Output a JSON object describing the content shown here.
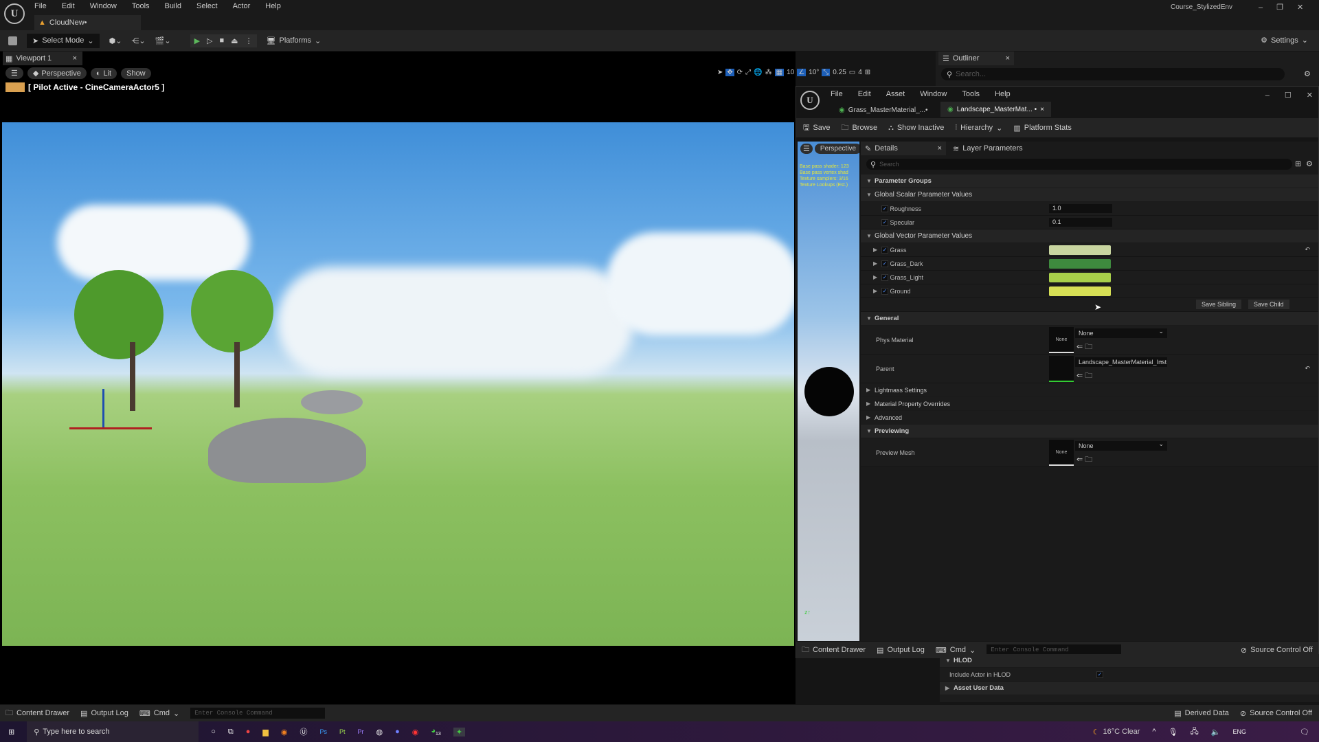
{
  "app": {
    "title": "Course_StylizedEnv",
    "menu": [
      "File",
      "Edit",
      "Window",
      "Tools",
      "Build",
      "Select",
      "Actor",
      "Help"
    ],
    "level_tab": "CloudNew•"
  },
  "toolbar": {
    "select_mode": "Select Mode",
    "platforms": "Platforms",
    "settings": "Settings"
  },
  "viewport": {
    "tab": "Viewport 1",
    "perspective": "Perspective",
    "lit": "Lit",
    "show": "Show",
    "pilot": "[ Pilot Active - CineCameraActor5 ]",
    "grid": "10",
    "angle": "10°",
    "scale": "0.25",
    "camera_speed": "4"
  },
  "outliner": {
    "tab": "Outliner",
    "search_placeholder": "Search..."
  },
  "material_editor": {
    "menu": [
      "File",
      "Edit",
      "Asset",
      "Window",
      "Tools",
      "Help"
    ],
    "tabs": [
      {
        "label": "Grass_MasterMaterial_...•"
      },
      {
        "label": "Landscape_MasterMat... •"
      }
    ],
    "toolbar": {
      "save": "Save",
      "browse": "Browse",
      "show_inactive": "Show Inactive",
      "hierarchy": "Hierarchy",
      "platform_stats": "Platform Stats"
    },
    "preview": {
      "perspective": "Perspective",
      "stats": [
        "Base pass shader: 123",
        "Base pass vertex shad",
        "Texture samplers: 3/16",
        "Texture Lookups (Est.)"
      ]
    },
    "details": {
      "tab": "Details",
      "layer_tab": "Layer Parameters",
      "search_placeholder": "Search",
      "parameter_groups": "Parameter Groups",
      "scalar_header": "Global Scalar Parameter Values",
      "scalars": [
        {
          "name": "Roughness",
          "value": "1.0",
          "enabled": true
        },
        {
          "name": "Specular",
          "value": "0.1",
          "enabled": true
        }
      ],
      "vector_header": "Global Vector Parameter Values",
      "vectors": [
        {
          "name": "Grass",
          "color": "#c8d5a0",
          "enabled": true
        },
        {
          "name": "Grass_Dark",
          "color": "#3e8a3e",
          "enabled": true
        },
        {
          "name": "Grass_Light",
          "color": "#a8cf4a",
          "enabled": true
        },
        {
          "name": "Ground",
          "color": "#d6df55",
          "enabled": true
        }
      ],
      "save_sibling": "Save Sibling",
      "save_child": "Save Child",
      "general": "General",
      "phys_material": "Phys Material",
      "phys_value": "None",
      "thumb_none": "None",
      "parent": "Parent",
      "parent_value": "Landscape_MasterMaterial_Inst",
      "lightmass": "Lightmass Settings",
      "mpo": "Material Property Overrides",
      "advanced": "Advanced",
      "previewing": "Previewing",
      "preview_mesh": "Preview Mesh",
      "preview_mesh_value": "None"
    },
    "bottom": {
      "content_drawer": "Content Drawer",
      "output_log": "Output Log",
      "cmd": "Cmd",
      "console_placeholder": "Enter Console Command",
      "source_control": "Source Control Off"
    }
  },
  "hlod": {
    "header": "HLOD",
    "include": "Include Actor in HLOD",
    "include_checked": true,
    "asset_user_data": "Asset User Data"
  },
  "statusbar": {
    "content_drawer": "Content Drawer",
    "output_log": "Output Log",
    "cmd": "Cmd",
    "console_placeholder": "Enter Console Command",
    "derived_data": "Derived Data",
    "source_control": "Source Control Off"
  },
  "taskbar": {
    "search_placeholder": "Type here to search",
    "weather": "16°C  Clear",
    "lang": "ENG",
    "whatsapp_badge": "13",
    "accent": "#3a1c46"
  }
}
